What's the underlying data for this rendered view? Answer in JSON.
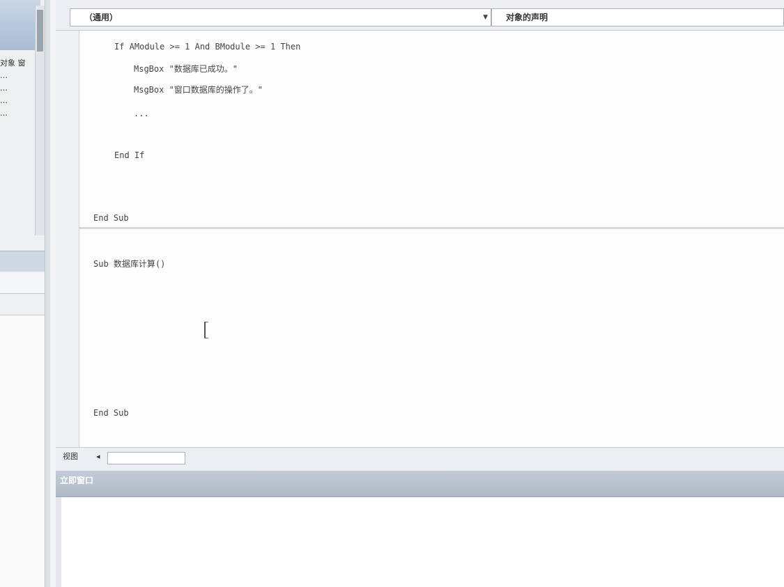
{
  "project_panel": {
    "tree_items": [
      "对象 窗",
      "…",
      "…",
      "…",
      "…"
    ]
  },
  "editor": {
    "object_combo": "（通用）",
    "procedure_combo": "对象的声明",
    "code_lines": [
      "If AModule >= 1 And BModule >= 1 Then",
      "MsgBox \"数据库已成功。\"",
      "MsgBox \"窗口数据库的操作了。\"",
      "...",
      "End If",
      "End Sub",
      "Sub 数据库计算()",
      "End Sub"
    ]
  },
  "bottom_bar": {
    "view_label": "视图"
  },
  "immediate": {
    "title": "立即窗口"
  }
}
